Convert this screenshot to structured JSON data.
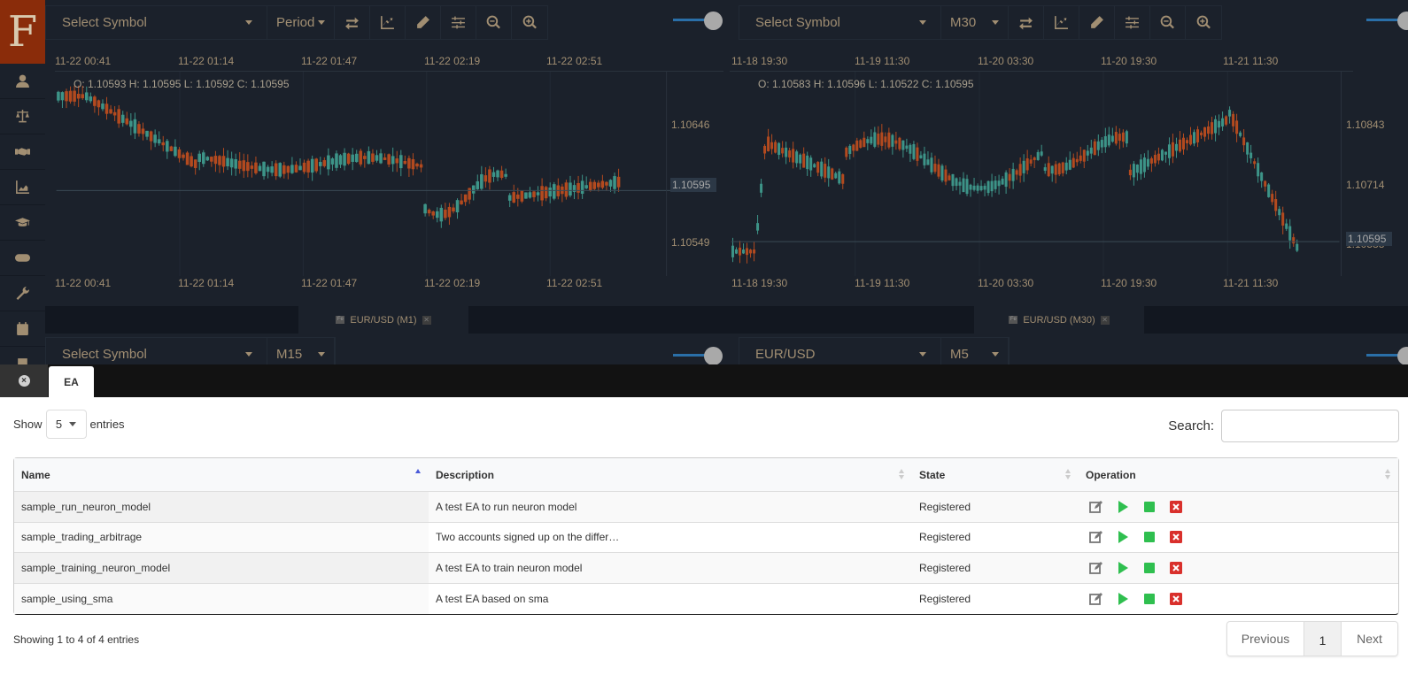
{
  "logo": "F",
  "sidebar": {
    "items": [
      {
        "icon": "user-icon"
      },
      {
        "icon": "balance-scale-icon"
      },
      {
        "icon": "handshake-icon"
      },
      {
        "icon": "area-chart-icon"
      },
      {
        "icon": "graduation-cap-icon"
      },
      {
        "icon": "gamepad-icon"
      },
      {
        "icon": "wrench-icon"
      },
      {
        "icon": "calendar-icon"
      }
    ]
  },
  "charts": [
    {
      "symbol_placeholder": "Select Symbol",
      "period": "Period",
      "time_ticks": [
        "11-22 00:41",
        "11-22 01:14",
        "11-22 01:47",
        "11-22 02:19",
        "11-22 02:51"
      ],
      "ohlc": "O: 1.10593 H: 1.10595 L: 1.10592 C: 1.10595",
      "price_ticks": [
        "1.10646",
        "1.10549"
      ],
      "current_price": "1.10595",
      "tab_label": "EUR/USD (M1)",
      "tab_icon": "Fe"
    },
    {
      "symbol_placeholder": "Select Symbol",
      "period": "M30",
      "time_ticks": [
        "11-18 19:30",
        "11-19 11:30",
        "11-20 03:30",
        "11-20 19:30",
        "11-21 11:30"
      ],
      "ohlc": "O: 1.10583 H: 1.10596 L: 1.10522 C: 1.10595",
      "price_ticks": [
        "1.10843",
        "1.10714",
        "1.10588"
      ],
      "current_price": "1.10595",
      "tab_label": "EUR/USD (M30)",
      "tab_icon": "Fe"
    }
  ],
  "row2": {
    "left_symbol": "Select Symbol",
    "left_period": "M15",
    "right_symbol": "EUR/USD",
    "right_period": "M5"
  },
  "panel": {
    "close_icon": "x",
    "tab_label": "EA",
    "show_label": "Show",
    "length_value": "5",
    "entries_label": "entries",
    "search_label": "Search:",
    "search_value": "",
    "columns": [
      "Name",
      "Description",
      "State",
      "Operation"
    ],
    "rows": [
      {
        "name": "sample_run_neuron_model",
        "description": "A test EA to run neuron model",
        "state": "Registered"
      },
      {
        "name": "sample_trading_arbitrage",
        "description": "Two accounts signed up on the differ…",
        "state": "Registered"
      },
      {
        "name": "sample_training_neuron_model",
        "description": "A test EA to train neuron model",
        "state": "Registered"
      },
      {
        "name": "sample_using_sma",
        "description": "A test EA based on sma",
        "state": "Registered"
      }
    ],
    "info": "Showing 1 to 4 of 4 entries",
    "pager": {
      "previous": "Previous",
      "page": "1",
      "next": "Next"
    }
  },
  "colors": {
    "brand": "#8a2c0a",
    "bull": "#3d9488",
    "bear": "#b34a1f",
    "play": "#2fbf4f",
    "stop": "#2fbf4f",
    "delete": "#d9302c"
  }
}
